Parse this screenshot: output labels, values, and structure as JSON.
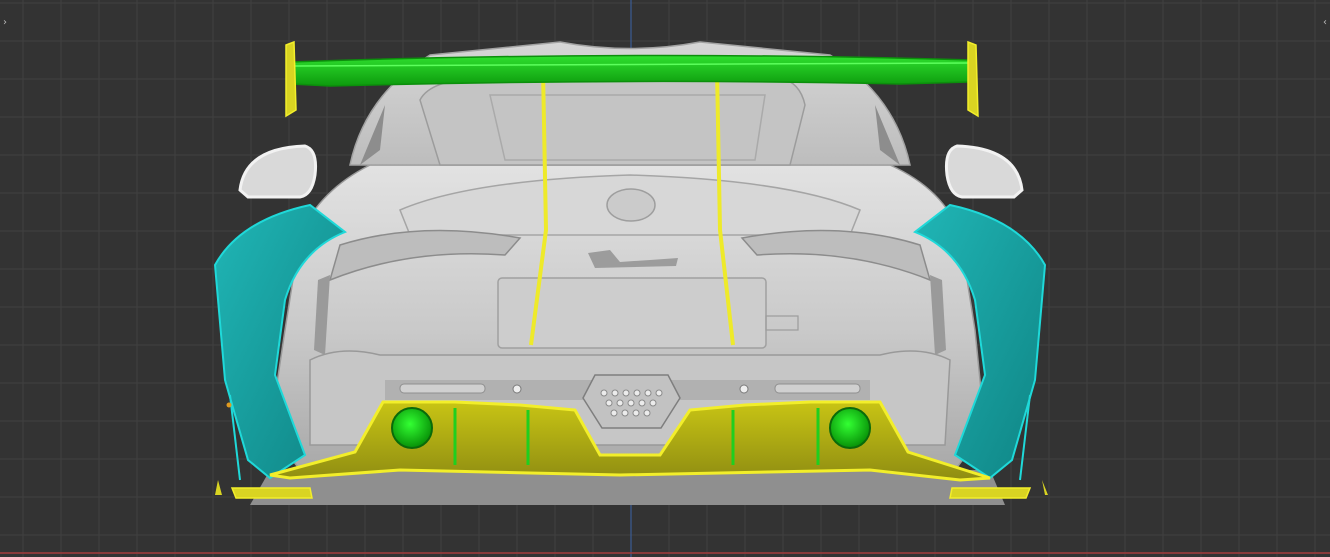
{
  "viewport": {
    "background_color": "#333333",
    "grid_color": "#404040",
    "axis_vertical_color": "#3b63a7",
    "axis_horizontal_color": "#a43c3c",
    "left_collapse_icon": "chevron-right-icon",
    "right_collapse_icon": "chevron-left-icon",
    "left_collapse_glyph": "›",
    "right_collapse_glyph": "‹"
  },
  "model": {
    "body_color": "#cfcfcf",
    "selected_wing_color": "#1fc41f",
    "yellow_highlight_color": "#d9d422",
    "teal_panel_color": "#1aa9a9",
    "exhaust_color": "#12c812"
  }
}
